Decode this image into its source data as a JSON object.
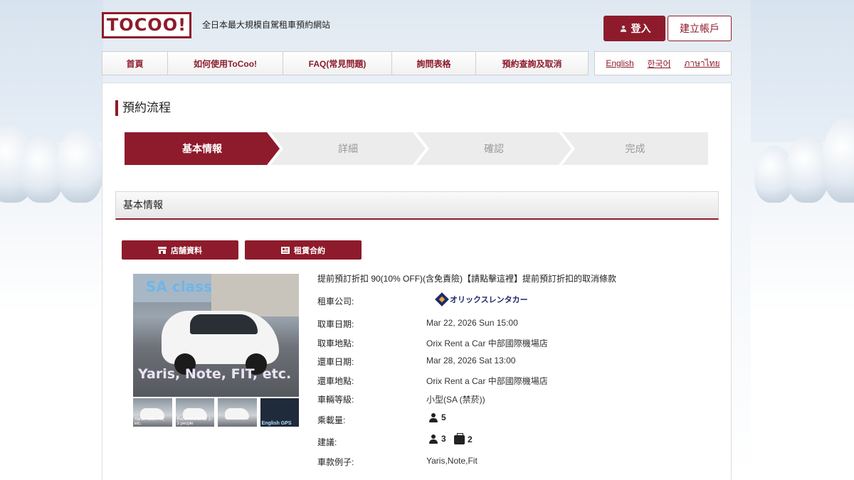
{
  "header": {
    "logo": "TOCOO!",
    "tagline": "全日本最大規模自駕租車預約網站",
    "login_label": "登入",
    "signup_label": "建立帳戶"
  },
  "nav": {
    "items": [
      {
        "label": "首頁"
      },
      {
        "label": "如何使用ToCoo!"
      },
      {
        "label": "FAQ(常見問題)"
      },
      {
        "label": "詢問表格"
      },
      {
        "label": "預約查詢及取消"
      }
    ],
    "languages": [
      "English",
      "한국어",
      "ภาษาไทย"
    ]
  },
  "main": {
    "title": "預約流程",
    "steps": [
      {
        "label": "基本情報",
        "active": true
      },
      {
        "label": "詳細",
        "active": false
      },
      {
        "label": "確認",
        "active": false
      },
      {
        "label": "完成",
        "active": false
      }
    ],
    "panel_title": "基本情報",
    "buttons": {
      "store_info": "店舗資料",
      "rental_contract": "租賃合約"
    },
    "photo": {
      "class_label": "SA class",
      "models_label": "Yaris, Note, FIT, etc.",
      "thumb_captions": [
        "Yaris, Note, FIT, etc.",
        "Recommend for 2-3 people",
        "",
        "English GPS"
      ]
    },
    "promo": "提前預訂折扣 90(10% OFF)(含免責險)【請點擊這裡】提前預訂折扣的取消條款",
    "info": {
      "company_label": "租車公司:",
      "company_name": "オリックスレンタカー",
      "pickup_date_label": "取車日期:",
      "pickup_date": "Mar 22, 2026 Sun 15:00",
      "pickup_place_label": "取車地點:",
      "pickup_place": "Orix Rent a Car 中部國際機場店",
      "return_date_label": "還車日期:",
      "return_date": "Mar 28, 2026 Sat 13:00",
      "return_place_label": "還車地點:",
      "return_place": "Orix Rent a Car 中部國際機場店",
      "class_label": "車輛等級:",
      "class_value": "小型(SA (禁菸))",
      "capacity_label": "乘載量:",
      "capacity_value": "5",
      "suggest_label": "建議:",
      "suggest_people": "3",
      "suggest_bags": "2",
      "models_label": "車款例子:",
      "models_value": "Yaris,Note,Fit"
    }
  },
  "colors": {
    "brand": "#8e1b2b",
    "step_inactive": "#ececec"
  }
}
